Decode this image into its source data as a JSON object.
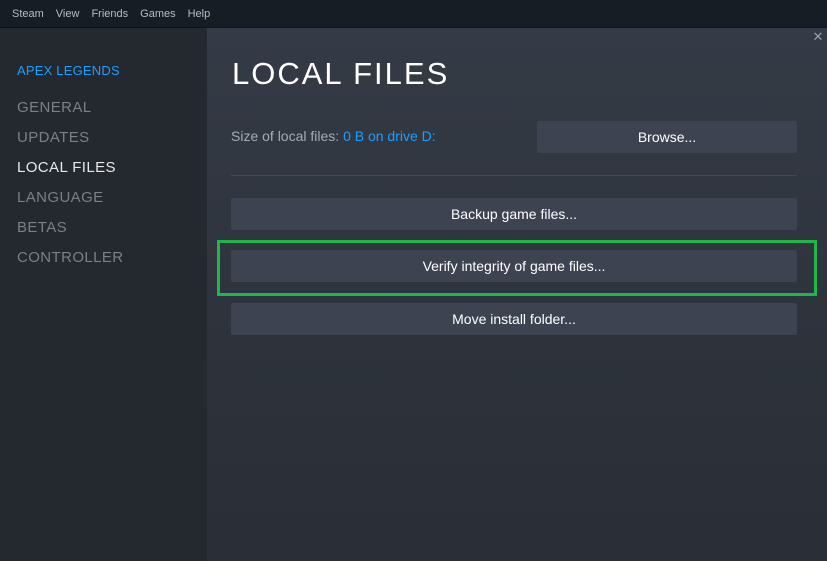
{
  "menu": {
    "items": [
      "Steam",
      "View",
      "Friends",
      "Games",
      "Help"
    ]
  },
  "sidebar": {
    "game_title": "APEX LEGENDS",
    "items": [
      {
        "label": "GENERAL",
        "active": false
      },
      {
        "label": "UPDATES",
        "active": false
      },
      {
        "label": "LOCAL FILES",
        "active": true
      },
      {
        "label": "LANGUAGE",
        "active": false
      },
      {
        "label": "BETAS",
        "active": false
      },
      {
        "label": "CONTROLLER",
        "active": false
      }
    ]
  },
  "main": {
    "close_icon": "close-icon",
    "close_glyph": "✕",
    "title": "LOCAL FILES",
    "size_label": "Size of local files:",
    "size_value": "0 B on drive D:",
    "browse_label": "Browse...",
    "backup_label": "Backup game files...",
    "verify_label": "Verify integrity of game files...",
    "move_label": "Move install folder..."
  },
  "colors": {
    "accent_blue": "#1a9fff",
    "highlight_green": "#1eb84a",
    "button_bg": "#3d4350"
  }
}
